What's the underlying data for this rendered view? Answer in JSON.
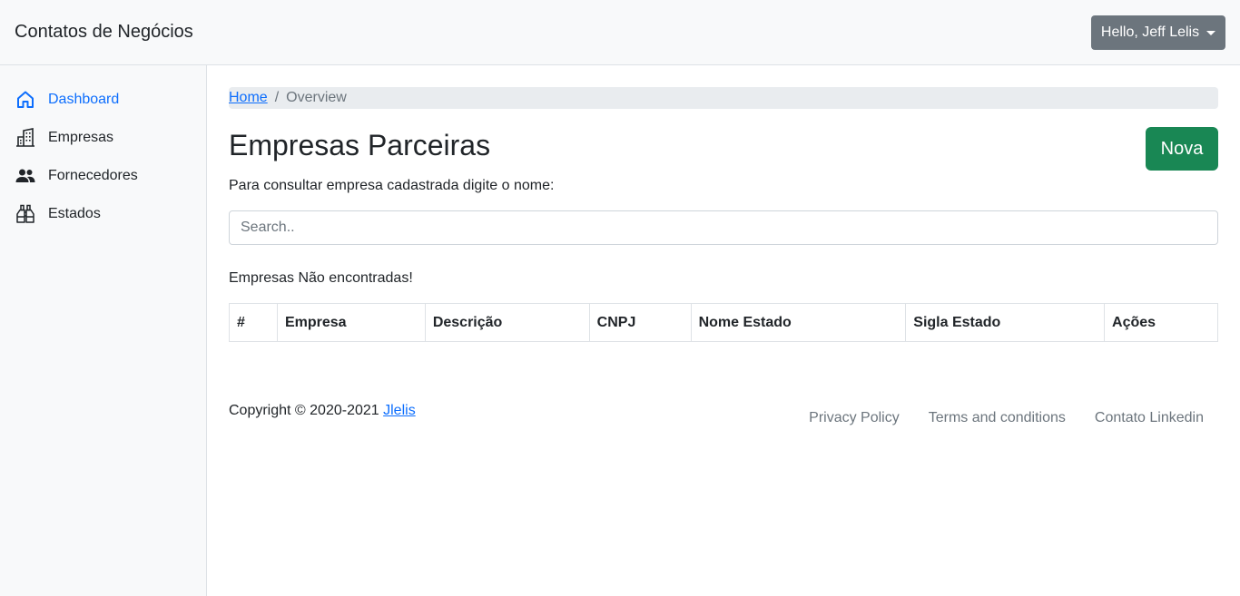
{
  "header": {
    "brand": "Contatos de Negócios",
    "user_menu_label": "Hello, Jeff Lelis"
  },
  "sidebar": {
    "items": [
      {
        "label": "Dashboard",
        "icon": "house-icon",
        "active": true
      },
      {
        "label": "Empresas",
        "icon": "building-icon",
        "active": false
      },
      {
        "label": "Fornecedores",
        "icon": "people-icon",
        "active": false
      },
      {
        "label": "Estados",
        "icon": "binoculars-icon",
        "active": false
      }
    ]
  },
  "breadcrumb": {
    "home": "Home",
    "separator": "/",
    "current": "Overview"
  },
  "page": {
    "title": "Empresas Parceiras",
    "new_button": "Nova",
    "help_text": "Para consultar empresa cadastrada digite o nome:",
    "search_placeholder": "Search..",
    "search_value": "",
    "not_found": "Empresas Não encontradas!"
  },
  "table": {
    "columns": [
      "#",
      "Empresa",
      "Descrição",
      "CNPJ",
      "Nome Estado",
      "Sigla Estado",
      "Ações"
    ],
    "rows": []
  },
  "footer": {
    "copyright": "Copyright © 2020-2021",
    "author_link": "Jlelis",
    "links": [
      "Privacy Policy",
      "Terms and conditions",
      "Contato Linkedin"
    ]
  },
  "colors": {
    "primary": "#0d6efd",
    "success": "#198754",
    "secondary": "#6c757d",
    "light": "#f8f9fa"
  }
}
